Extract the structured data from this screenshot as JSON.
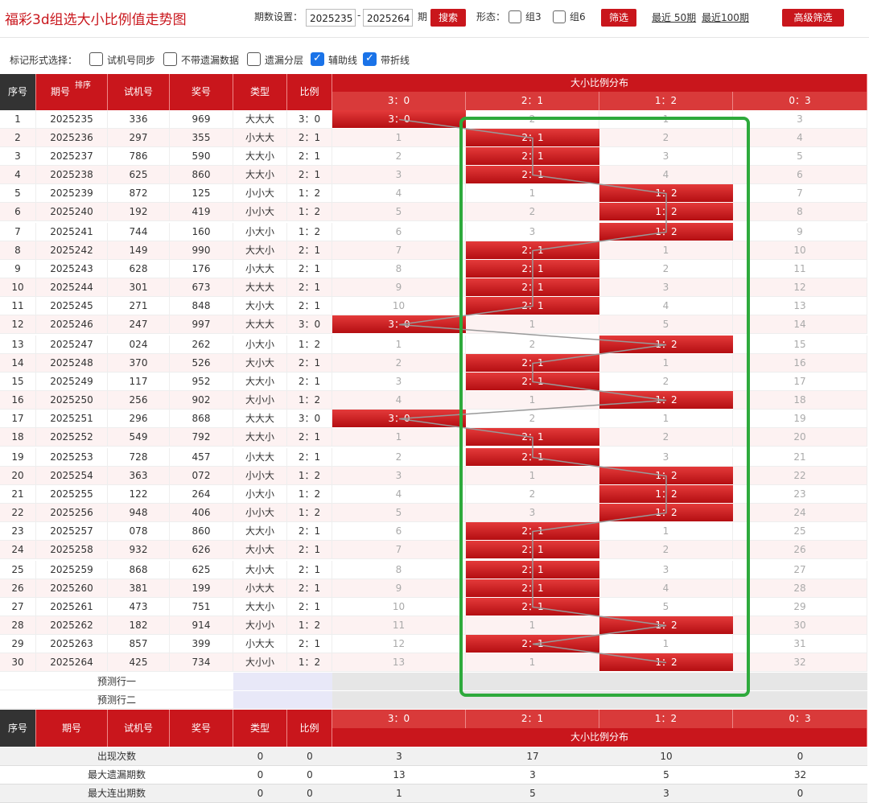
{
  "header": {
    "title": "福彩3d组选大小比例值走势图",
    "period_label": "期数设置：",
    "period_from": "2025235",
    "period_sep": "-",
    "period_to": "2025264",
    "period_unit": "期",
    "search_label": "搜索",
    "shape_label": "形态：",
    "group3_label": "组3",
    "group6_label": "组6",
    "filter_label": "筛选",
    "recent50": "最近 50期",
    "recent100": "最近100期",
    "advanced_label": "高级筛选"
  },
  "options": {
    "label": "标记形式选择：",
    "items": [
      {
        "label": "试机号同步",
        "checked": false
      },
      {
        "label": "不带遗漏数据",
        "checked": false
      },
      {
        "label": "遗漏分层",
        "checked": false
      },
      {
        "label": "辅助线",
        "checked": true
      },
      {
        "label": "带折线",
        "checked": true
      }
    ]
  },
  "table": {
    "headers": {
      "seq": "序号",
      "period": "期号",
      "sort": "排序",
      "trial": "试机号",
      "award": "奖号",
      "type": "类型",
      "ratio": "比例",
      "dist": "大小比例分布"
    },
    "dist_cols": [
      "3：0",
      "2：1",
      "1：2",
      "0：3"
    ],
    "rows": [
      {
        "seq": "1",
        "period": "2025235",
        "trial": "336",
        "award": "969",
        "type": "大大大",
        "ratio": "3：0",
        "hit": 0,
        "miss": [
          "",
          "2",
          "1",
          "3"
        ]
      },
      {
        "seq": "2",
        "period": "2025236",
        "trial": "297",
        "award": "355",
        "type": "小大大",
        "ratio": "2：1",
        "hit": 1,
        "miss": [
          "1",
          "",
          "2",
          "4"
        ]
      },
      {
        "seq": "3",
        "period": "2025237",
        "trial": "786",
        "award": "590",
        "type": "大大小",
        "ratio": "2：1",
        "hit": 1,
        "miss": [
          "2",
          "",
          "3",
          "5"
        ]
      },
      {
        "seq": "4",
        "period": "2025238",
        "trial": "625",
        "award": "860",
        "type": "大大小",
        "ratio": "2：1",
        "hit": 1,
        "miss": [
          "3",
          "",
          "4",
          "6"
        ]
      },
      {
        "seq": "5",
        "period": "2025239",
        "trial": "872",
        "award": "125",
        "type": "小小大",
        "ratio": "1：2",
        "hit": 2,
        "miss": [
          "4",
          "1",
          "",
          "7"
        ]
      },
      {
        "seq": "6",
        "period": "2025240",
        "trial": "192",
        "award": "419",
        "type": "小小大",
        "ratio": "1：2",
        "hit": 2,
        "miss": [
          "5",
          "2",
          "",
          "8"
        ]
      },
      {
        "seq": "7",
        "period": "2025241",
        "trial": "744",
        "award": "160",
        "type": "小大小",
        "ratio": "1：2",
        "hit": 2,
        "miss": [
          "6",
          "3",
          "",
          "9"
        ]
      },
      {
        "seq": "8",
        "period": "2025242",
        "trial": "149",
        "award": "990",
        "type": "大大小",
        "ratio": "2：1",
        "hit": 1,
        "miss": [
          "7",
          "",
          "1",
          "10"
        ]
      },
      {
        "seq": "9",
        "period": "2025243",
        "trial": "628",
        "award": "176",
        "type": "小大大",
        "ratio": "2：1",
        "hit": 1,
        "miss": [
          "8",
          "",
          "2",
          "11"
        ]
      },
      {
        "seq": "10",
        "period": "2025244",
        "trial": "301",
        "award": "673",
        "type": "大大大",
        "ratio": "2：1",
        "hit": 1,
        "miss": [
          "9",
          "",
          "3",
          "12"
        ]
      },
      {
        "seq": "11",
        "period": "2025245",
        "trial": "271",
        "award": "848",
        "type": "大小大",
        "ratio": "2：1",
        "hit": 1,
        "miss": [
          "10",
          "",
          "4",
          "13"
        ]
      },
      {
        "seq": "12",
        "period": "2025246",
        "trial": "247",
        "award": "997",
        "type": "大大大",
        "ratio": "3：0",
        "hit": 0,
        "miss": [
          "",
          "1",
          "5",
          "14"
        ]
      },
      {
        "seq": "13",
        "period": "2025247",
        "trial": "024",
        "award": "262",
        "type": "小大小",
        "ratio": "1：2",
        "hit": 2,
        "miss": [
          "1",
          "2",
          "",
          "15"
        ]
      },
      {
        "seq": "14",
        "period": "2025248",
        "trial": "370",
        "award": "526",
        "type": "大小大",
        "ratio": "2：1",
        "hit": 1,
        "miss": [
          "2",
          "",
          "1",
          "16"
        ]
      },
      {
        "seq": "15",
        "period": "2025249",
        "trial": "117",
        "award": "952",
        "type": "大大小",
        "ratio": "2：1",
        "hit": 1,
        "miss": [
          "3",
          "",
          "2",
          "17"
        ]
      },
      {
        "seq": "16",
        "period": "2025250",
        "trial": "256",
        "award": "902",
        "type": "大小小",
        "ratio": "1：2",
        "hit": 2,
        "miss": [
          "4",
          "1",
          "",
          "18"
        ]
      },
      {
        "seq": "17",
        "period": "2025251",
        "trial": "296",
        "award": "868",
        "type": "大大大",
        "ratio": "3：0",
        "hit": 0,
        "miss": [
          "",
          "2",
          "1",
          "19"
        ]
      },
      {
        "seq": "18",
        "period": "2025252",
        "trial": "549",
        "award": "792",
        "type": "大大小",
        "ratio": "2：1",
        "hit": 1,
        "miss": [
          "1",
          "",
          "2",
          "20"
        ]
      },
      {
        "seq": "19",
        "period": "2025253",
        "trial": "728",
        "award": "457",
        "type": "小大大",
        "ratio": "2：1",
        "hit": 1,
        "miss": [
          "2",
          "",
          "3",
          "21"
        ]
      },
      {
        "seq": "20",
        "period": "2025254",
        "trial": "363",
        "award": "072",
        "type": "小小大",
        "ratio": "1：2",
        "hit": 2,
        "miss": [
          "3",
          "1",
          "",
          "22"
        ]
      },
      {
        "seq": "21",
        "period": "2025255",
        "trial": "122",
        "award": "264",
        "type": "小大小",
        "ratio": "1：2",
        "hit": 2,
        "miss": [
          "4",
          "2",
          "",
          "23"
        ]
      },
      {
        "seq": "22",
        "period": "2025256",
        "trial": "948",
        "award": "406",
        "type": "小小大",
        "ratio": "1：2",
        "hit": 2,
        "miss": [
          "5",
          "3",
          "",
          "24"
        ]
      },
      {
        "seq": "23",
        "period": "2025257",
        "trial": "078",
        "award": "860",
        "type": "大大小",
        "ratio": "2：1",
        "hit": 1,
        "miss": [
          "6",
          "",
          "1",
          "25"
        ]
      },
      {
        "seq": "24",
        "period": "2025258",
        "trial": "932",
        "award": "626",
        "type": "大小大",
        "ratio": "2：1",
        "hit": 1,
        "miss": [
          "7",
          "",
          "2",
          "26"
        ]
      },
      {
        "seq": "25",
        "period": "2025259",
        "trial": "868",
        "award": "625",
        "type": "大小大",
        "ratio": "2：1",
        "hit": 1,
        "miss": [
          "8",
          "",
          "3",
          "27"
        ]
      },
      {
        "seq": "26",
        "period": "2025260",
        "trial": "381",
        "award": "199",
        "type": "小大大",
        "ratio": "2：1",
        "hit": 1,
        "miss": [
          "9",
          "",
          "4",
          "28"
        ]
      },
      {
        "seq": "27",
        "period": "2025261",
        "trial": "473",
        "award": "751",
        "type": "大大小",
        "ratio": "2：1",
        "hit": 1,
        "miss": [
          "10",
          "",
          "5",
          "29"
        ]
      },
      {
        "seq": "28",
        "period": "2025262",
        "trial": "182",
        "award": "914",
        "type": "大小小",
        "ratio": "1：2",
        "hit": 2,
        "miss": [
          "11",
          "1",
          "",
          "30"
        ]
      },
      {
        "seq": "29",
        "period": "2025263",
        "trial": "857",
        "award": "399",
        "type": "小大大",
        "ratio": "2：1",
        "hit": 1,
        "miss": [
          "12",
          "",
          "1",
          "31"
        ]
      },
      {
        "seq": "30",
        "period": "2025264",
        "trial": "425",
        "award": "734",
        "type": "大小小",
        "ratio": "1：2",
        "hit": 2,
        "miss": [
          "13",
          "1",
          "",
          "32"
        ]
      }
    ],
    "predict": [
      "预测行一",
      "预测行二"
    ],
    "stats": [
      {
        "label": "出现次数",
        "type": "0",
        "ratio": "0",
        "vals": [
          "3",
          "17",
          "10",
          "0"
        ]
      },
      {
        "label": "最大遗漏期数",
        "type": "0",
        "ratio": "0",
        "vals": [
          "13",
          "3",
          "5",
          "32"
        ]
      },
      {
        "label": "最大连出期数",
        "type": "0",
        "ratio": "0",
        "vals": [
          "1",
          "5",
          "3",
          "0"
        ]
      }
    ]
  },
  "colors": {
    "accent": "#c9161c",
    "highlight_box": "#2eaa3c"
  }
}
